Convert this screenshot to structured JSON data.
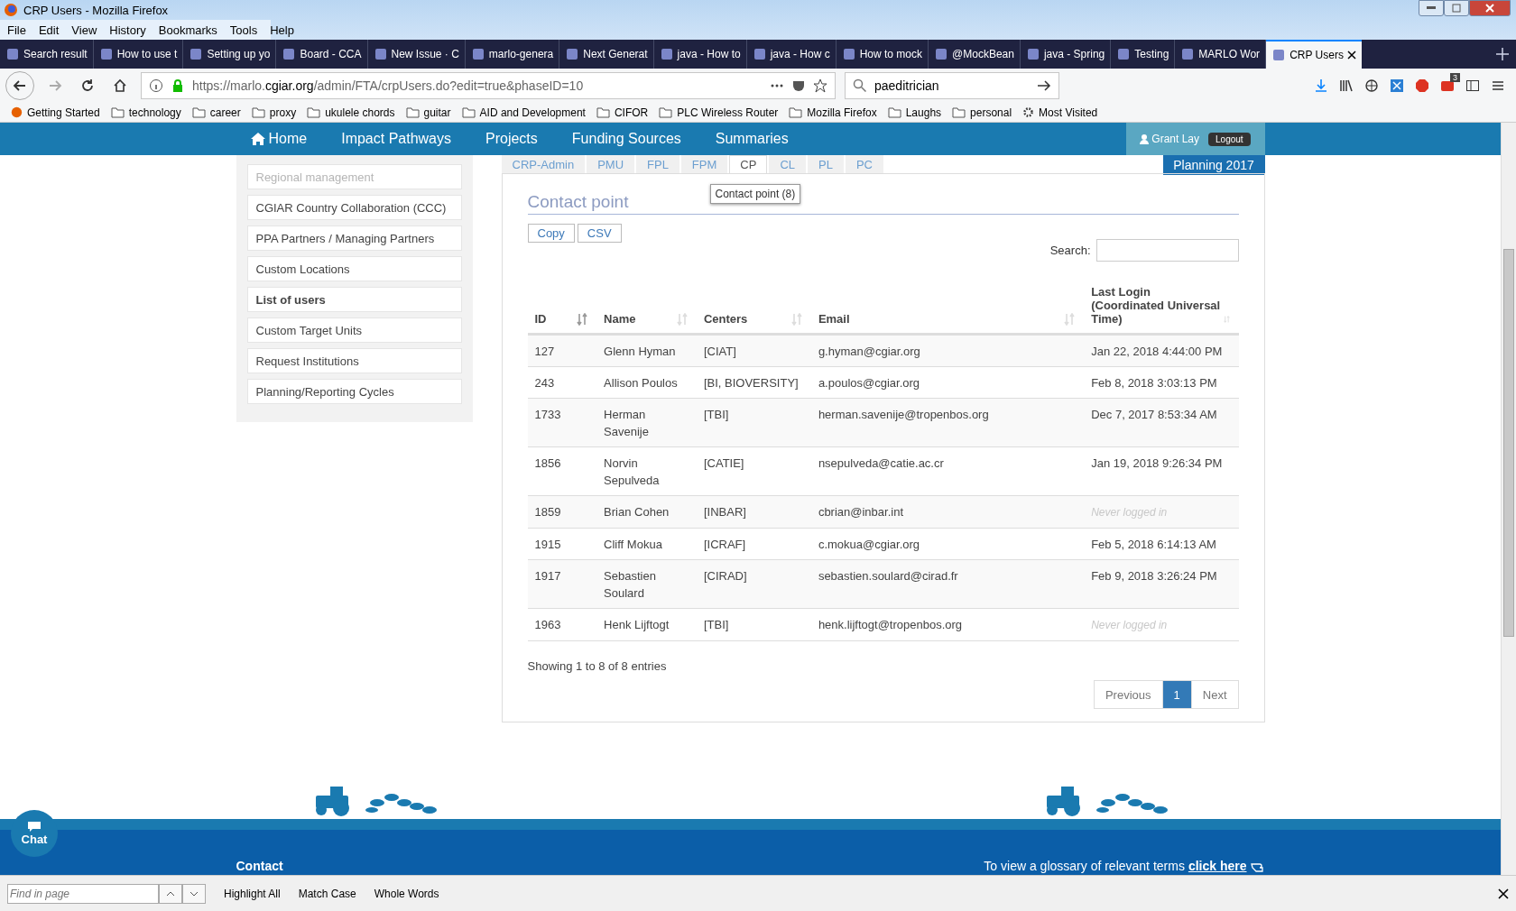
{
  "window": {
    "title": "CRP Users - Mozilla Firefox"
  },
  "menu": [
    "File",
    "Edit",
    "View",
    "History",
    "Bookmarks",
    "Tools",
    "Help"
  ],
  "browser_tabs": [
    {
      "label": "Search result",
      "selected": false
    },
    {
      "label": "How to use t",
      "selected": false
    },
    {
      "label": "Setting up yo",
      "selected": false
    },
    {
      "label": "Board - CCA",
      "selected": false
    },
    {
      "label": "New Issue · C",
      "selected": false
    },
    {
      "label": "marlo-genera",
      "selected": false
    },
    {
      "label": "Next Generat",
      "selected": false
    },
    {
      "label": "java - How to",
      "selected": false
    },
    {
      "label": "java - How c",
      "selected": false
    },
    {
      "label": "How to mock",
      "selected": false
    },
    {
      "label": "@MockBean",
      "selected": false
    },
    {
      "label": "java - Spring",
      "selected": false
    },
    {
      "label": "Testing",
      "selected": false
    },
    {
      "label": "MARLO Wor",
      "selected": false
    },
    {
      "label": "CRP Users",
      "selected": true
    }
  ],
  "address": {
    "prefix": "https://marlo.",
    "domain": "cgiar.org",
    "path": "/admin/FTA/crpUsers.do?edit=true&phaseID=10"
  },
  "browser_search": {
    "value": "paeditrician"
  },
  "toolbar_badge": "3",
  "bookmarks": [
    "Getting Started",
    "technology",
    "career",
    "proxy",
    "ukulele chords",
    "guitar",
    "AID and Development",
    "CIFOR",
    "PLC Wireless Router",
    "Mozilla Firefox",
    "Laughs",
    "personal",
    "Most Visited"
  ],
  "nav": {
    "items": [
      "Home",
      "Impact Pathways",
      "Projects",
      "Funding Sources",
      "Summaries"
    ],
    "user": "Grant Lay",
    "logout": "Logout",
    "phase": "Planning 2017"
  },
  "sidebar": {
    "items": [
      {
        "label": "Regional management",
        "disabled": true,
        "selected": false
      },
      {
        "label": "CGIAR Country Collaboration (CCC)",
        "disabled": false,
        "selected": false
      },
      {
        "label": "PPA Partners / Managing Partners",
        "disabled": false,
        "selected": false
      },
      {
        "label": "Custom Locations",
        "disabled": false,
        "selected": false
      },
      {
        "label": "List of users",
        "disabled": false,
        "selected": true
      },
      {
        "label": "Custom Target Units",
        "disabled": false,
        "selected": false
      },
      {
        "label": "Request Institutions",
        "disabled": false,
        "selected": false
      },
      {
        "label": "Planning/Reporting Cycles",
        "disabled": false,
        "selected": false
      }
    ]
  },
  "role_tabs": [
    {
      "label": "CRP-Admin",
      "selected": false
    },
    {
      "label": "PMU",
      "selected": false
    },
    {
      "label": "FPL",
      "selected": false
    },
    {
      "label": "FPM",
      "selected": false
    },
    {
      "label": "CP",
      "selected": true
    },
    {
      "label": "CL",
      "selected": false
    },
    {
      "label": "PL",
      "selected": false
    },
    {
      "label": "PC",
      "selected": false
    }
  ],
  "tooltip": "Contact point (8)",
  "section_title": "Contact point",
  "export_buttons": [
    "Copy",
    "CSV"
  ],
  "search": {
    "label": "Search:"
  },
  "table": {
    "columns": [
      {
        "label": "ID",
        "sorted": true
      },
      {
        "label": "Name",
        "sorted": false
      },
      {
        "label": "Centers",
        "sorted": false
      },
      {
        "label": "Email",
        "sorted": false
      },
      {
        "label": "Last Login (Coordinated Universal Time)",
        "sorted": false
      }
    ],
    "rows": [
      {
        "id": "127",
        "name": "Glenn Hyman",
        "centers": "[CIAT]",
        "email": "g.hyman@cgiar.org",
        "last_login": "Jan 22, 2018 4:44:00 PM",
        "never_logged_in": false
      },
      {
        "id": "243",
        "name": "Allison Poulos",
        "centers": "[BI, BIOVERSITY]",
        "email": "a.poulos@cgiar.org",
        "last_login": "Feb 8, 2018 3:03:13 PM",
        "never_logged_in": false
      },
      {
        "id": "1733",
        "name": "Herman Savenije",
        "centers": "[TBI]",
        "email": "herman.savenije@tropenbos.org",
        "last_login": "Dec 7, 2017 8:53:34 AM",
        "never_logged_in": false
      },
      {
        "id": "1856",
        "name": "Norvin Sepulveda",
        "centers": "[CATIE]",
        "email": "nsepulveda@catie.ac.cr",
        "last_login": "Jan 19, 2018 9:26:34 PM",
        "never_logged_in": false
      },
      {
        "id": "1859",
        "name": "Brian Cohen",
        "centers": "[INBAR]",
        "email": "cbrian@inbar.int",
        "last_login": "Never logged in",
        "never_logged_in": true
      },
      {
        "id": "1915",
        "name": "Cliff Mokua",
        "centers": "[ICRAF]",
        "email": "c.mokua@cgiar.org",
        "last_login": "Feb 5, 2018 6:14:13 AM",
        "never_logged_in": false
      },
      {
        "id": "1917",
        "name": "Sebastien Soulard",
        "centers": "[CIRAD]",
        "email": "sebastien.soulard@cirad.fr",
        "last_login": "Feb 9, 2018 3:26:24 PM",
        "never_logged_in": false
      },
      {
        "id": "1963",
        "name": "Henk Lijftogt",
        "centers": "[TBI]",
        "email": "henk.lijftogt@tropenbos.org",
        "last_login": "Never logged in",
        "never_logged_in": true
      }
    ]
  },
  "table_info": "Showing 1 to 8 of 8 entries",
  "pagination": [
    {
      "label": "Previous",
      "selected": false
    },
    {
      "label": "1",
      "selected": true
    },
    {
      "label": "Next",
      "selected": false
    }
  ],
  "chat": "Chat",
  "footer": {
    "contact": "Contact",
    "glossary_text": "To view a glossary of relevant terms",
    "glossary_link": "click here"
  },
  "find_bar": {
    "placeholder": "Find in page",
    "options": [
      "Highlight All",
      "Match Case",
      "Whole Words"
    ]
  }
}
